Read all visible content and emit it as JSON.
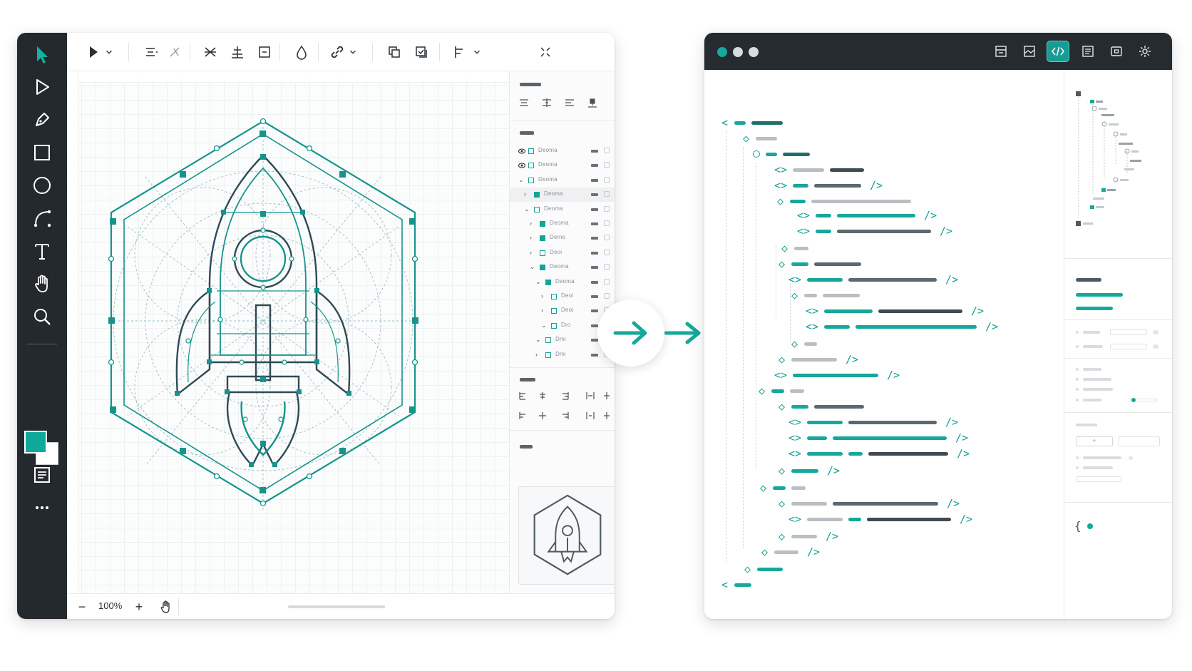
{
  "editor": {
    "zoom": "100%",
    "zoom_minus": "−",
    "zoom_plus": "+",
    "tools": [
      "select-arrow",
      "direct-select",
      "pen",
      "rectangle",
      "ellipse",
      "bezier-curve",
      "text",
      "hand",
      "zoom",
      "panel",
      "more"
    ],
    "toolbar_icons": [
      "play-select",
      "chevron-down",
      "align-center",
      "distribute",
      "flip",
      "align-middle",
      "frame",
      "boolean-union",
      "link",
      "chevron-down",
      "duplicate",
      "copy-style",
      "align-left",
      "chevron-down",
      "collapse"
    ],
    "fill_color": "#11a89c",
    "stroke_color": "#ffffff",
    "layers": [
      {
        "name": "Deoma"
      },
      {
        "name": "Deoma"
      },
      {
        "name": "Deoma"
      },
      {
        "name": "Deoma"
      },
      {
        "name": "Deoma"
      },
      {
        "name": "Deoma"
      },
      {
        "name": "Deme"
      },
      {
        "name": "Deoi"
      },
      {
        "name": "Deoma"
      },
      {
        "name": "Deoma"
      },
      {
        "name": "Deoi"
      },
      {
        "name": "Deoi"
      },
      {
        "name": "Dro"
      },
      {
        "name": "Dmi"
      },
      {
        "name": "Dmi"
      }
    ]
  },
  "code": {
    "window_dots": [
      "#18a89c",
      "#d9dcdf",
      "#d9dcdf"
    ],
    "toolbar_icons": [
      "layout",
      "image",
      "code",
      "list",
      "frame",
      "gear"
    ],
    "accent": "#159d93",
    "side_brace": "{",
    "glyphs": {
      "open": "<",
      "tag": "<>",
      "close": "/>",
      "node": "◇"
    }
  }
}
